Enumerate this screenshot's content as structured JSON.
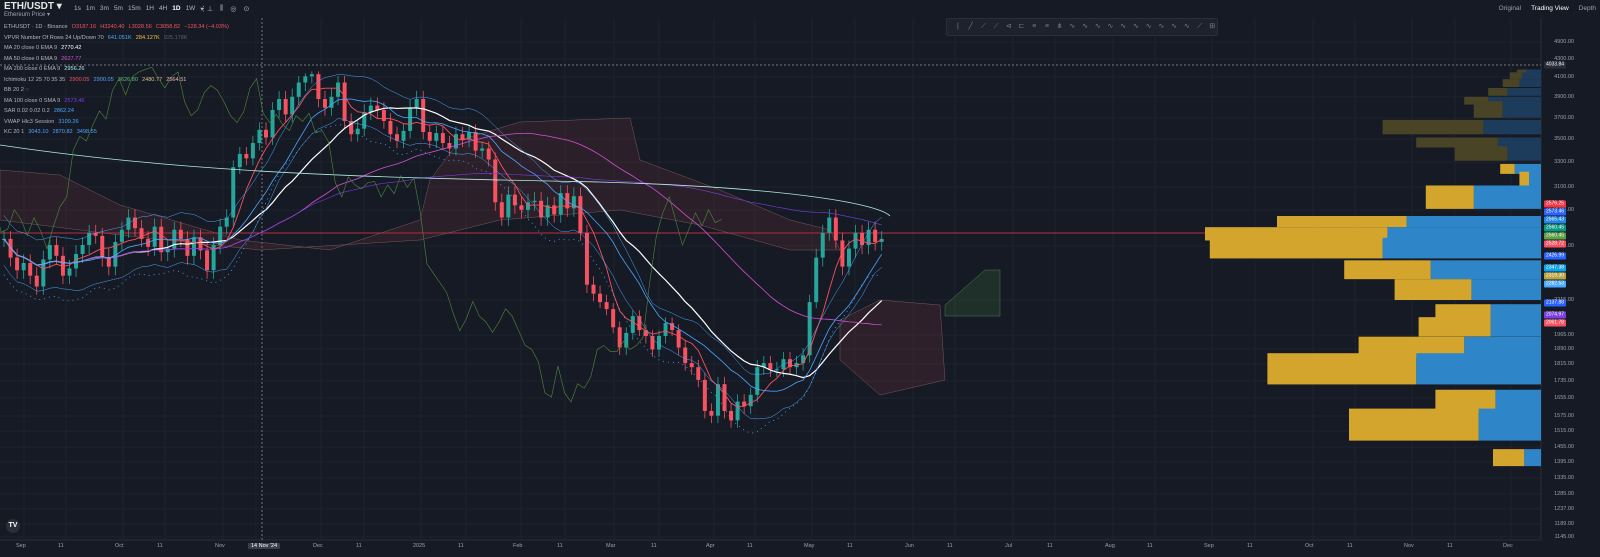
{
  "header": {
    "symbol": "ETH/USDT",
    "symbol_caret": "▾",
    "subtitle": "Ethereum Price ▾",
    "timeframes": [
      "1s",
      "1m",
      "3m",
      "5m",
      "15m",
      "1H",
      "4H",
      "1D",
      "1W",
      "▾"
    ],
    "active_timeframe": "1D",
    "tools": [
      "⋮⊥",
      "⫼",
      "◎",
      "⊙"
    ],
    "views": [
      "Original",
      "Trading View",
      "Depth"
    ],
    "active_view": "Trading View"
  },
  "legend": [
    {
      "label": "ETHUSDT · 1D · Binance",
      "values": [
        {
          "t": "O3187.16",
          "c": "#f7525f"
        },
        {
          "t": "H3240.40",
          "c": "#f7525f"
        },
        {
          "t": "L3028.56",
          "c": "#f7525f"
        },
        {
          "t": "C3058.82",
          "c": "#f7525f"
        },
        {
          "t": "−128.34 (−4.03%)",
          "c": "#f7525f"
        }
      ]
    },
    {
      "label": "VPVR Number Of Rows 24 Up/Down 70",
      "values": [
        {
          "t": "641.051K",
          "c": "#4aa8ff"
        },
        {
          "t": "284.127K",
          "c": "#f0c040"
        },
        {
          "t": "925.178K",
          "c": "#5d606b"
        }
      ]
    },
    {
      "label": "MA 20 close 0 EMA 9",
      "values": [
        {
          "t": "2770.42",
          "c": "#ffffff"
        }
      ]
    },
    {
      "label": "MA 50 close 0 EMA 9",
      "values": [
        {
          "t": "2627.77",
          "c": "#d54fd6"
        }
      ]
    },
    {
      "label": "MA 200 close 0 EMA 9",
      "values": [
        {
          "t": "2956.26",
          "c": "#b2ebe6"
        }
      ]
    },
    {
      "label": "Ichimoku 12 25 70 35 35",
      "values": [
        {
          "t": "2900.05",
          "c": "#f7525f"
        },
        {
          "t": "2900.05",
          "c": "#4aa8ff"
        },
        {
          "t": "3626.80",
          "c": "#5ec07a"
        },
        {
          "t": "2480.77",
          "c": "#d8c27a"
        },
        {
          "t": "2564.51",
          "c": "#f7b3b8"
        }
      ]
    },
    {
      "label": "BB 20 2  ◌",
      "values": []
    },
    {
      "label": "MA 100 close 0 SMA 9",
      "values": [
        {
          "t": "2573.46",
          "c": "#7b3fe4"
        }
      ]
    },
    {
      "label": "SAR 0.02 0.02 0.2",
      "values": [
        {
          "t": "2862.24",
          "c": "#4aa8ff"
        }
      ]
    },
    {
      "label": "VWAP Hlc3 Session",
      "values": [
        {
          "t": "3109.26",
          "c": "#4aa8ff"
        }
      ]
    },
    {
      "label": "KC 20 1",
      "values": [
        {
          "t": "3043.10",
          "c": "#4aa8ff"
        },
        {
          "t": "2870.82",
          "c": "#4aa8ff"
        },
        {
          "t": "3498.55",
          "c": "#4aa8ff"
        }
      ]
    }
  ],
  "drawing_tools": [
    "|",
    "╱",
    "⟋",
    "⟋",
    "⊲",
    "⊏",
    "≡",
    "≡",
    "⋔",
    "∿",
    "∿",
    "∿",
    "∿",
    "∿",
    "∿",
    "∿",
    "∿",
    "∿",
    "∿",
    "⟋",
    "⊞"
  ],
  "price_axis": {
    "ticks": [
      "4900.00",
      "4300.00",
      "4100.00",
      "3900.00",
      "3700.00",
      "3500.00",
      "3300.00",
      "3100.00",
      "2900.00",
      "2520.00",
      "2215.00",
      "1965.00",
      "1890.00",
      "1815.00",
      "1735.00",
      "1655.00",
      "1575.00",
      "1515.00",
      "1455.00",
      "1395.00",
      "1335.00",
      "1285.00",
      "1237.00",
      "1189.00",
      "1145.00"
    ],
    "crosshair_price": "4033.84",
    "labels": [
      {
        "t": "2576.25",
        "c": "#f23645"
      },
      {
        "t": "2573.46",
        "c": "#2962ff"
      },
      {
        "t": "2565.43",
        "c": "#1e88e5"
      },
      {
        "t": "2560.45",
        "c": "#089981"
      },
      {
        "t": "2560.45",
        "c": "#5e9f3f"
      },
      {
        "t": "2528.72",
        "c": "#f7525f"
      },
      {
        "t": "2426.99",
        "c": "#2962ff"
      },
      {
        "t": "2347.38",
        "c": "#0ea5e9"
      },
      {
        "t": "2319.30",
        "c": "#b5a642"
      },
      {
        "t": "2282.53",
        "c": "#4aa8ff"
      },
      {
        "t": "2137.88",
        "c": "#2962ff"
      },
      {
        "t": "2074.97",
        "c": "#7b3fe4"
      },
      {
        "t": "2061.78",
        "c": "#f7525f"
      }
    ]
  },
  "time_axis": [
    "Sep",
    "11",
    "Oct",
    "11",
    "Nov",
    "14 Nov '24",
    "Dec",
    "11",
    "2025",
    "11",
    "Feb",
    "11",
    "Mar",
    "11",
    "Apr",
    "11",
    "May",
    "11",
    "Jun",
    "11",
    "Jul",
    "11",
    "Aug",
    "11",
    "Sep",
    "11",
    "Oct",
    "11",
    "Nov",
    "11",
    "Dec"
  ],
  "time_axis_highlight": "14 Nov '24",
  "logo": "TV",
  "colors": {
    "bg": "#161a25",
    "up": "#26a69a",
    "down": "#f7525f",
    "vol_up": "#2e86c8",
    "vol_down": "#d4a52c"
  },
  "chart_data": {
    "type": "candlestick",
    "symbol": "ETHUSDT",
    "interval": "1D",
    "exchange": "Binance",
    "ylim": [
      1145,
      4900
    ],
    "x_range": [
      "Sep",
      "Dec"
    ],
    "last": {
      "open": 3187.16,
      "high": 3240.4,
      "low": 3028.56,
      "close": 3058.82,
      "change": -128.34,
      "change_pct": -4.03
    },
    "volume_profile": {
      "rows": 24,
      "up_total": "641.051K",
      "down_total": "284.127K",
      "total": "925.178K",
      "levels": [
        {
          "price": 4000,
          "up": 4,
          "down": 6
        },
        {
          "price": 3920,
          "up": 5,
          "down": 8
        },
        {
          "price": 3840,
          "up": 7,
          "down": 9
        },
        {
          "price": 3760,
          "up": 8,
          "down": 14
        },
        {
          "price": 3680,
          "up": 10,
          "down": 22
        },
        {
          "price": 3600,
          "up": 12,
          "down": 16
        },
        {
          "price": 3440,
          "up": 42,
          "down": 24
        },
        {
          "price": 3300,
          "up": 34,
          "down": 18
        },
        {
          "price": 3200,
          "up": 22,
          "down": 14
        },
        {
          "price": 3060,
          "up": 6,
          "down": 11
        },
        {
          "price": 2960,
          "up": 4,
          "down": 5
        },
        {
          "price": 2830,
          "up": 20,
          "down": 28
        },
        {
          "price": 2670,
          "up": 54,
          "down": 56
        },
        {
          "price": 2590,
          "up": 76,
          "down": 64
        },
        {
          "price": 2500,
          "up": 72,
          "down": 66
        },
        {
          "price": 2380,
          "up": 36,
          "down": 46
        },
        {
          "price": 2270,
          "up": 32,
          "down": 29
        },
        {
          "price": 2130,
          "up": 23,
          "down": 21
        },
        {
          "price": 2020,
          "up": 30,
          "down": 21
        },
        {
          "price": 1900,
          "up": 44,
          "down": 32
        },
        {
          "price": 1790,
          "up": 62,
          "down": 52
        },
        {
          "price": 1640,
          "up": 25,
          "down": 19
        },
        {
          "price": 1540,
          "up": 54,
          "down": 26
        },
        {
          "price": 1410,
          "up": 13,
          "down": 7
        }
      ]
    },
    "close_path": [
      2560,
      2450,
      2380,
      2420,
      2350,
      2290,
      2440,
      2520,
      2460,
      2350,
      2390,
      2470,
      2520,
      2600,
      2580,
      2450,
      2400,
      2540,
      2620,
      2700,
      2630,
      2560,
      2510,
      2640,
      2480,
      2500,
      2620,
      2560,
      2460,
      2570,
      2490,
      2380,
      2520,
      2640,
      2700,
      3080,
      3200,
      3160,
      3300,
      3420,
      3350,
      3600,
      3700,
      3560,
      3720,
      3850,
      3920,
      3980,
      3700,
      3620,
      3720,
      3850,
      3500,
      3380,
      3430,
      3580,
      3640,
      3600,
      3500,
      3380,
      3320,
      3410,
      3620,
      3700,
      3400,
      3320,
      3390,
      3300,
      3250,
      3380,
      3330,
      3400,
      3230,
      3250,
      3150,
      2800,
      2700,
      2850,
      2780,
      2750,
      2800,
      2810,
      2700,
      2780,
      2720,
      2860,
      2760,
      2840,
      2600,
      2300,
      2250,
      2200,
      2150,
      2020,
      1900,
      1980,
      2100,
      2000,
      1960,
      1890,
      1960,
      2050,
      2000,
      1900,
      1820,
      1800,
      1740,
      1600,
      1580,
      1720,
      1600,
      1560,
      1640,
      1620,
      1670,
      1800,
      1820,
      1790,
      1790,
      1840,
      1800,
      1820,
      1860,
      2200,
      2450,
      2600,
      2700,
      2550,
      2400,
      2500,
      2600,
      2520,
      2620,
      2540,
      2560
    ]
  }
}
